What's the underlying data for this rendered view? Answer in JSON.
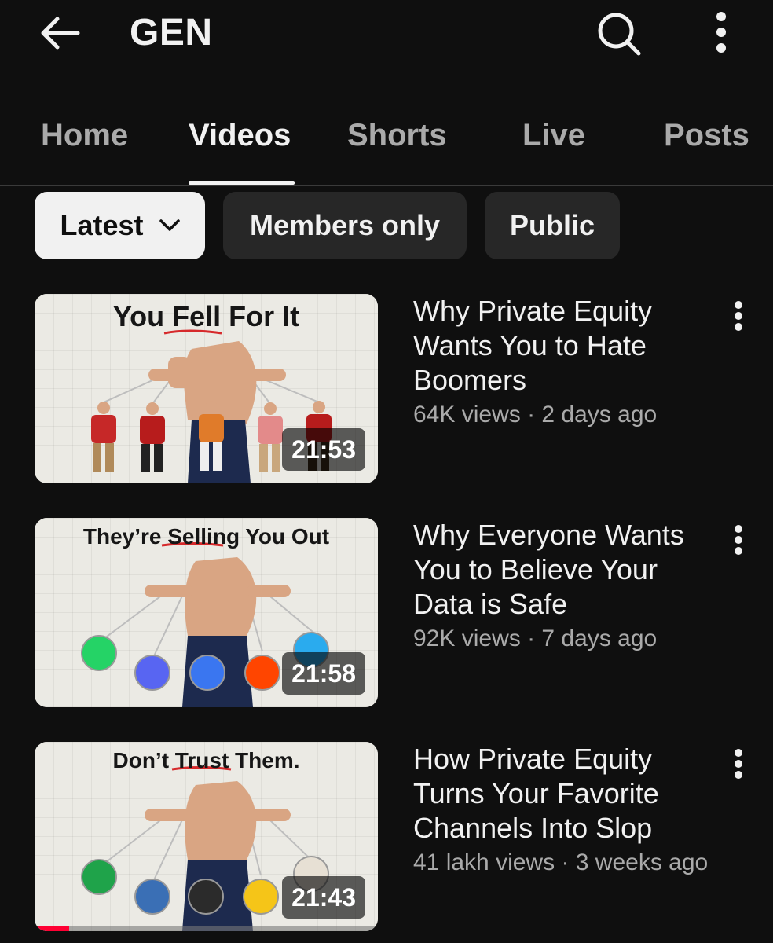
{
  "header": {
    "channel_name": "GEN",
    "back_icon": "arrow-left-icon",
    "search_icon": "search-icon",
    "more_icon": "more-vertical-icon"
  },
  "tabs": [
    {
      "label": "Home",
      "active": false
    },
    {
      "label": "Videos",
      "active": true
    },
    {
      "label": "Shorts",
      "active": false
    },
    {
      "label": "Live",
      "active": false
    },
    {
      "label": "Posts",
      "active": false
    }
  ],
  "filters": [
    {
      "label": "Latest",
      "selected": true,
      "icon": "chevron-down-icon"
    },
    {
      "label": "Members only",
      "selected": false
    },
    {
      "label": "Public",
      "selected": false
    }
  ],
  "videos": [
    {
      "thumbnail_headline": "You Fell For It",
      "thumbnail_highlight": "Fell",
      "duration": "21:53",
      "title": "Why Private Equity Wants You to Hate Boomers",
      "views": "64K views",
      "age": "2 days ago",
      "watched_fraction": 0
    },
    {
      "thumbnail_headline": "They’re Selling You Out",
      "thumbnail_highlight": "Selling",
      "duration": "21:58",
      "title": "Why Everyone Wants You to Believe Your Data is Safe",
      "views": "92K views",
      "age": "7 days ago",
      "watched_fraction": 0
    },
    {
      "thumbnail_headline": "Don’t Trust Them.",
      "thumbnail_highlight": "Trust",
      "duration": "21:43",
      "title": "How Private Equity Turns Your Favorite Channels Into Slop",
      "views": "41 lakh views",
      "age": "3 weeks ago",
      "watched_fraction": 0.1
    }
  ],
  "separator": "·",
  "colors": {
    "background": "#0f0f0f",
    "chip_background": "#272727",
    "chip_selected": "#f1f1f1",
    "secondary_text": "#aaaaaa",
    "progress": "#ff0033",
    "highlight_underline": "#d6292b"
  }
}
